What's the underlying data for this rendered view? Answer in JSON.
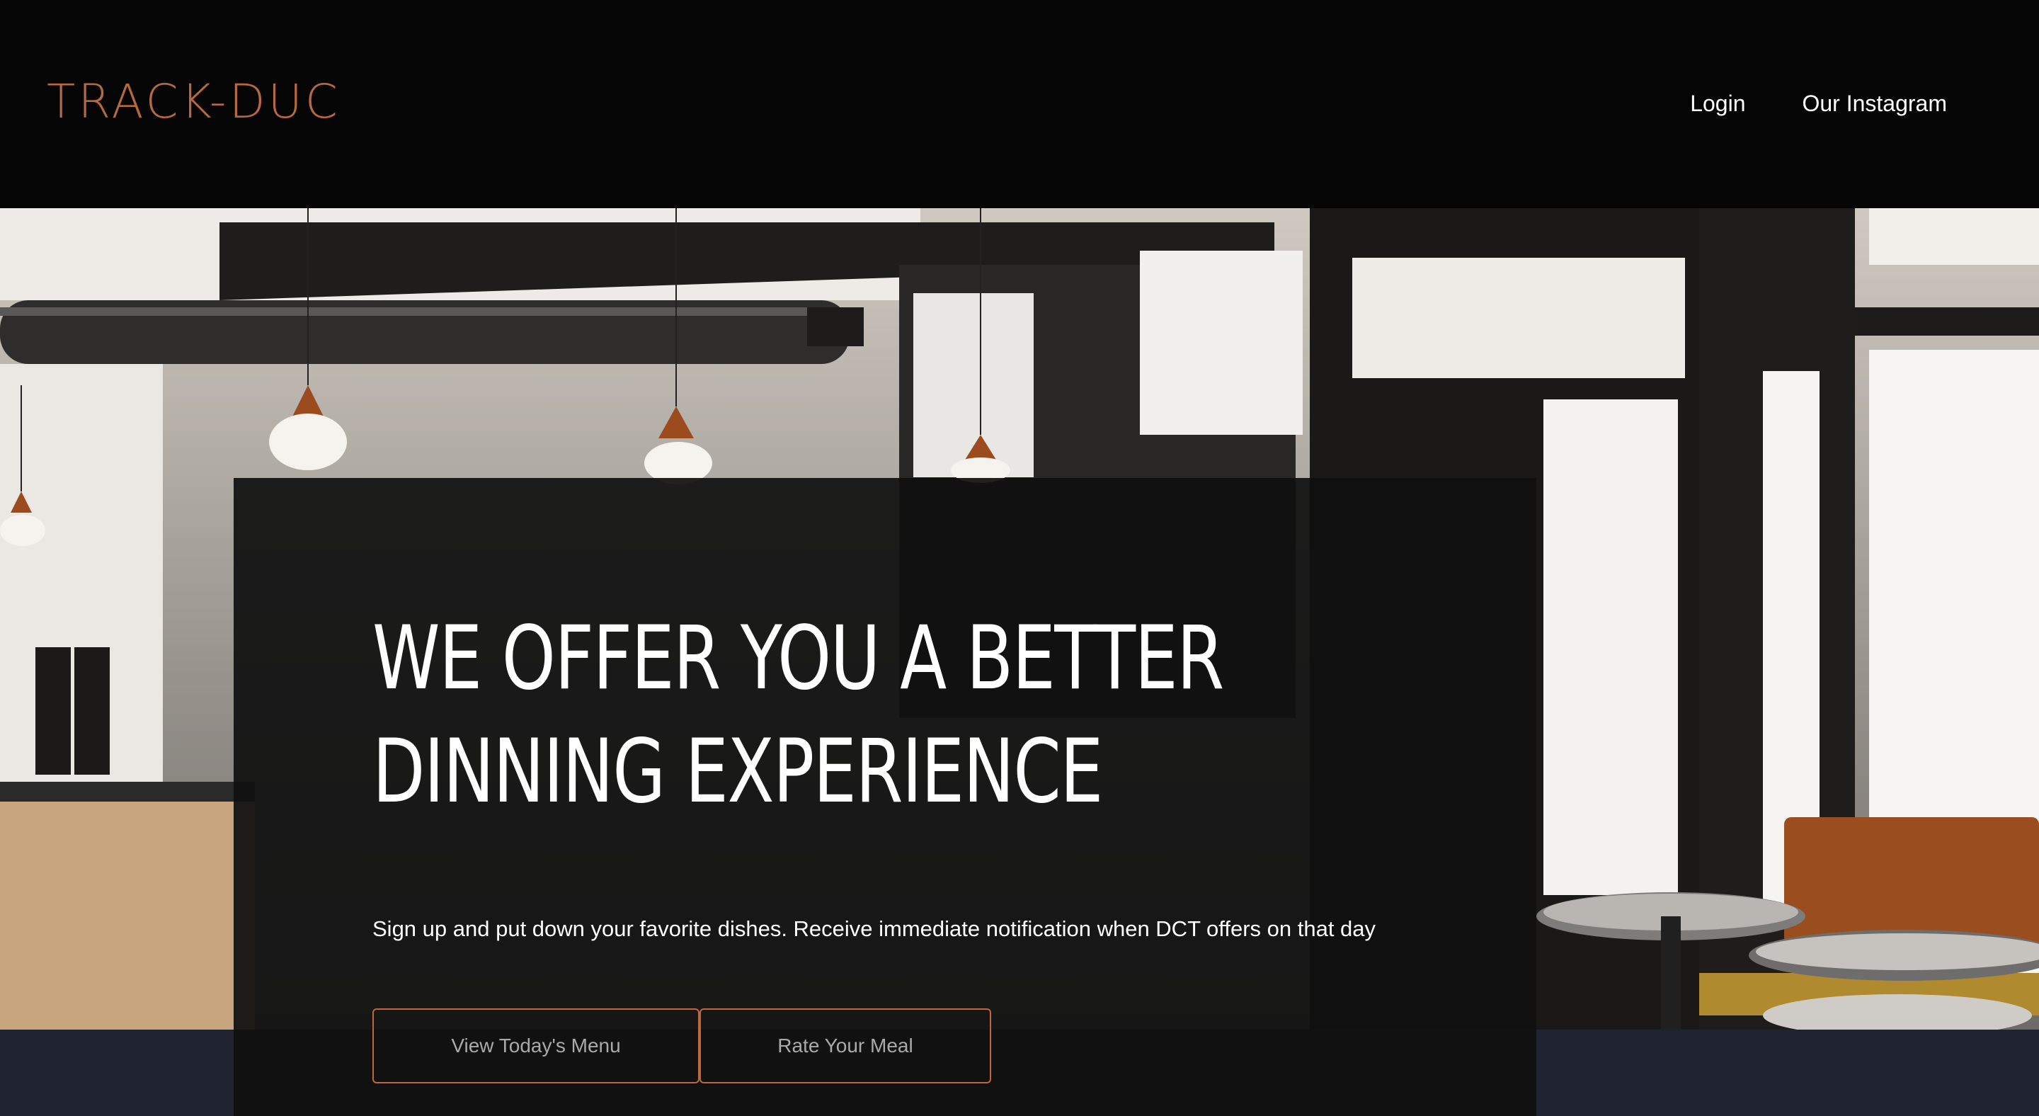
{
  "brand": {
    "logo_text": "TRACK-DUC",
    "accent_color": "#b7693e"
  },
  "nav": {
    "login_label": "Login",
    "instagram_label": "Our Instagram"
  },
  "hero": {
    "headline_line1": "WE OFFER YOU A BETTER",
    "headline_line2": "DINNING EXPERIENCE",
    "subtext": "Sign up and put down your favorite dishes. Receive immediate notification when DCT offers on that day",
    "buttons": {
      "menu_label": "View Today's Menu",
      "rate_label": "Rate Your Meal"
    }
  },
  "colors": {
    "header_bg": "#050505",
    "overlay_bg": "#101010",
    "button_border": "#c0683d",
    "bottom_band": "#1f2430"
  }
}
